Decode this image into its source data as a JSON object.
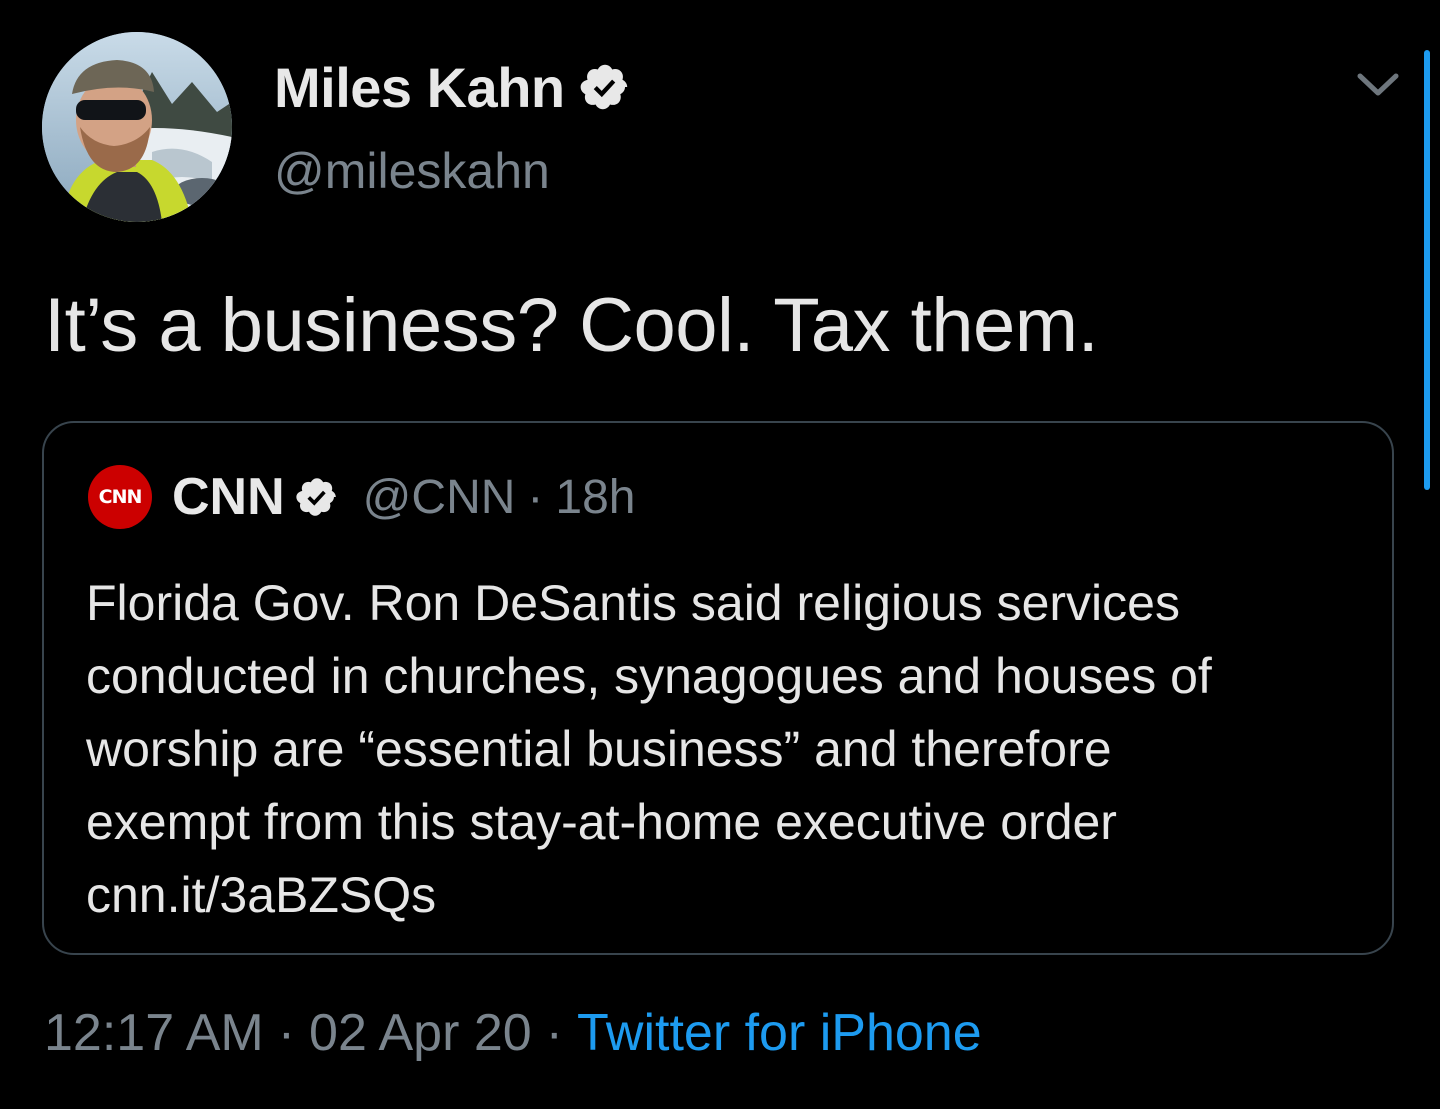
{
  "author": {
    "name": "Miles Kahn",
    "handle": "@mileskahn",
    "verified": true,
    "avatar_icon": "profile-photo"
  },
  "tweet": {
    "text": "It’s a business? Cool. Tax them."
  },
  "quoted_tweet": {
    "logo_text": "CNN",
    "name": "CNN",
    "verified": true,
    "handle": "@CNN",
    "separator": "·",
    "time": "18h",
    "body_lines": [
      "Florida Gov. Ron DeSantis said religious services",
      "conducted in churches, synagogues and houses of",
      "worship are “essential business” and therefore",
      "exempt from this stay-at-home executive order",
      "cnn.it/3aBZSQs"
    ]
  },
  "meta": {
    "time": "12:17 AM",
    "separator": "·",
    "date": "02 Apr 20",
    "source": "Twitter for iPhone"
  },
  "colors": {
    "background": "#000000",
    "text": "#e6e6e6",
    "muted": "#7a848d",
    "accent": "#1d9bf0",
    "border": "#38444d",
    "cnn_red": "#cc0000"
  },
  "icons": {
    "verified": "verified-badge-icon",
    "caret": "chevron-down-icon",
    "cnn": "cnn-logo"
  }
}
